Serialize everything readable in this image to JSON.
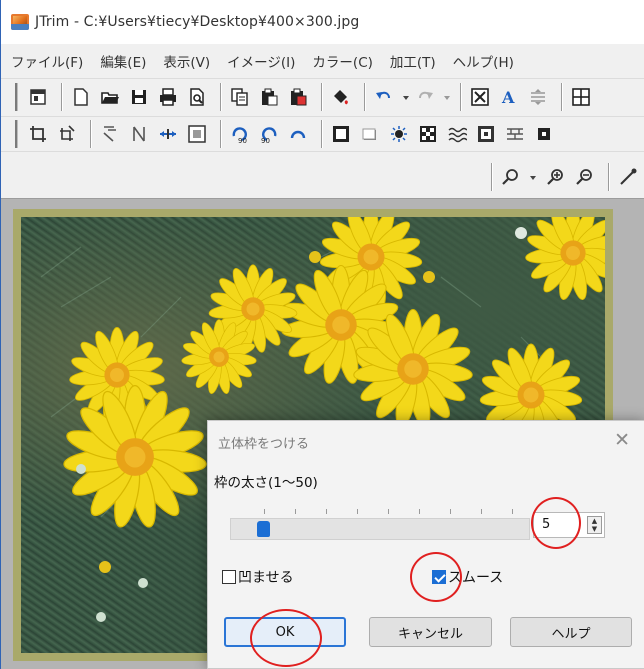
{
  "window": {
    "title": "JTrim - C:¥Users¥tiecy¥Desktop¥400×300.jpg"
  },
  "menu": [
    {
      "label": "ファイル(F)"
    },
    {
      "label": "編集(E)"
    },
    {
      "label": "表示(V)"
    },
    {
      "label": "イメージ(I)"
    },
    {
      "label": "カラー(C)"
    },
    {
      "label": "加工(T)"
    },
    {
      "label": "ヘルプ(H)"
    }
  ],
  "dialog": {
    "title": "立体枠をつける",
    "close_glyph": "✕",
    "thickness_label": "枠の太さ(1〜50)",
    "thickness_value": "5",
    "slider": {
      "min": 1,
      "max": 50,
      "value": 5
    },
    "spin_up": "▲",
    "spin_down": "▼",
    "emboss_label": "凹ませる",
    "emboss_checked": false,
    "smooth_label": "スムース",
    "smooth_checked": true,
    "ok_label": "OK",
    "cancel_label": "キャンセル",
    "help_label": "ヘルプ"
  },
  "colors": {
    "accent": "#1b6ed4",
    "annotation": "#e02020",
    "frame": "#a9a96a",
    "workspace": "#b4b4b4"
  }
}
